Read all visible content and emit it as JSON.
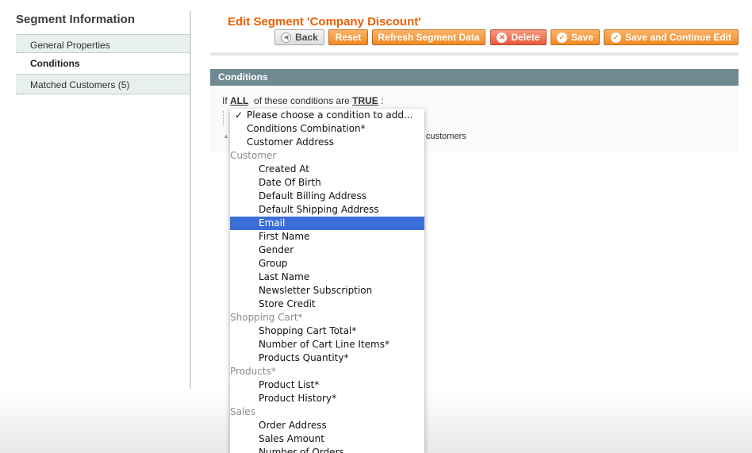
{
  "sidebar": {
    "title": "Segment Information",
    "tabs": [
      {
        "label": "General Properties"
      },
      {
        "label": "Conditions"
      },
      {
        "label": "Matched Customers (5)"
      }
    ]
  },
  "header": {
    "title": "Edit Segment 'Company Discount'",
    "buttons": {
      "back": "Back",
      "reset": "Reset",
      "refresh": "Refresh Segment Data",
      "delete": "Delete",
      "save": "Save",
      "save_continue": "Save and Continue Edit"
    }
  },
  "conditions": {
    "section_title": "Conditions",
    "rule": {
      "prefix": "If",
      "aggregator": "ALL",
      "middle": "of these conditions are",
      "value": "TRUE",
      "suffix": ":"
    },
    "behind_text": "customers"
  },
  "dropdown": {
    "selected_mark": "✓",
    "options": [
      {
        "label": "Please choose a condition to add...",
        "kind": "selected"
      },
      {
        "label": "Conditions Combination*",
        "kind": "l0"
      },
      {
        "label": "Customer Address",
        "kind": "l0"
      },
      {
        "label": "Customer",
        "kind": "group"
      },
      {
        "label": "Created At",
        "kind": "l1"
      },
      {
        "label": "Date Of Birth",
        "kind": "l1"
      },
      {
        "label": "Default Billing Address",
        "kind": "l1"
      },
      {
        "label": "Default Shipping Address",
        "kind": "l1"
      },
      {
        "label": "Email",
        "kind": "l1",
        "highlighted": true
      },
      {
        "label": "First Name",
        "kind": "l1"
      },
      {
        "label": "Gender",
        "kind": "l1"
      },
      {
        "label": "Group",
        "kind": "l1"
      },
      {
        "label": "Last Name",
        "kind": "l1"
      },
      {
        "label": "Newsletter Subscription",
        "kind": "l1"
      },
      {
        "label": "Store Credit",
        "kind": "l1"
      },
      {
        "label": "Shopping Cart*",
        "kind": "group"
      },
      {
        "label": "Shopping Cart Total*",
        "kind": "l1"
      },
      {
        "label": "Number of Cart Line Items*",
        "kind": "l1"
      },
      {
        "label": "Products Quantity*",
        "kind": "l1"
      },
      {
        "label": "Products*",
        "kind": "group"
      },
      {
        "label": "Product List*",
        "kind": "l1"
      },
      {
        "label": "Product History*",
        "kind": "l1"
      },
      {
        "label": "Sales",
        "kind": "group"
      },
      {
        "label": "Order Address",
        "kind": "l1"
      },
      {
        "label": "Sales Amount",
        "kind": "l1"
      },
      {
        "label": "Number of Orders",
        "kind": "l1"
      }
    ]
  },
  "colors": {
    "title_orange": "#eb5e00",
    "button_orange": "#f18a24",
    "delete_red": "#e9583a",
    "section_bar": "#6f8992",
    "highlight_blue": "#3a6fd8"
  }
}
